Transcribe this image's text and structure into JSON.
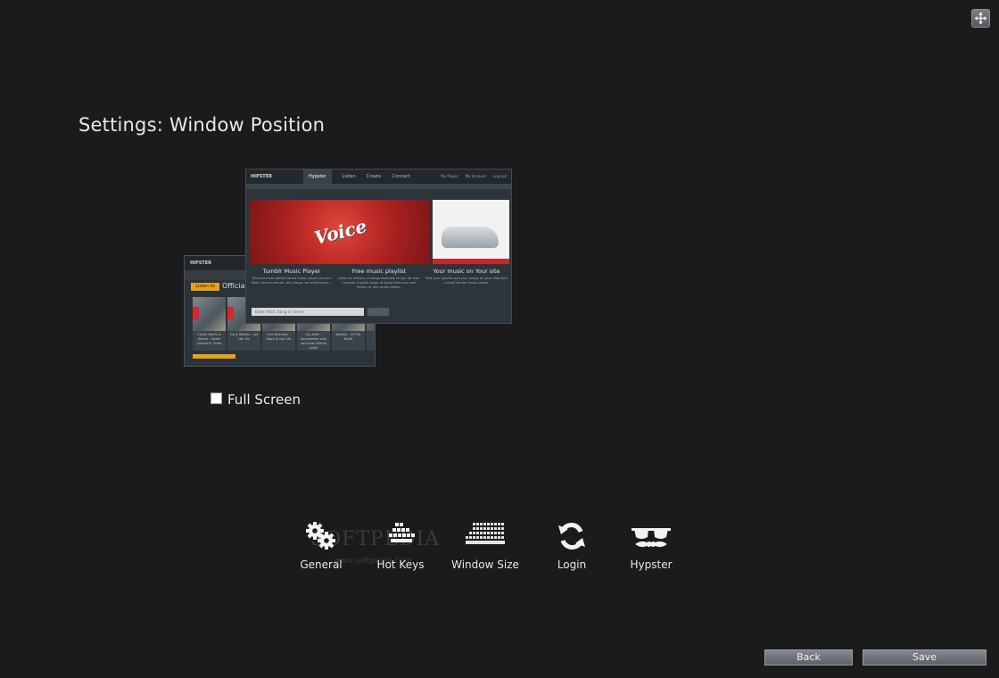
{
  "title": "Settings: Window Position",
  "fullscreen": {
    "label": "Full Screen",
    "checked": false
  },
  "preview": {
    "front": {
      "logo": "HIPSTER",
      "nav": [
        "Hypster",
        "Listen",
        "Create",
        "Connect"
      ],
      "right_links": [
        "My Player",
        "My Account",
        "Log out"
      ],
      "banner_text": "Voice",
      "columns": [
        {
          "heading": "Tumblr Music Player",
          "text": "Find out more details about music player on your blog. How to embed, why songs not working etc..."
        },
        {
          "heading": "Free music playlist",
          "text": "Listen to millions of songs available to you for free. Uncover a great range of songs from our vast library of free music online."
        },
        {
          "heading": "Your music on Your site",
          "text": "Post your playlist and your songs on your blog with a small tumblr music player."
        }
      ],
      "search_placeholder": "Enter Artist, Song or Genre"
    },
    "back": {
      "logo": "HIPSTER",
      "tab": "Listen to",
      "heading": "Official U",
      "thumbs": [
        "Calvin Harris & Alesso - Under Control ft. Hurts",
        "Carly Rothon - Let Her Go",
        "One Direction - Story of my Life",
        "Lily Allen - Somewhere only we know Official Audio",
        "Bastille - Of The Night",
        "Me"
      ]
    }
  },
  "watermark": {
    "text": "SOFTPEDIA",
    "sub": "www.softpedia.com"
  },
  "nav": [
    {
      "label": "General",
      "icon": "gears-icon"
    },
    {
      "label": "Hot Keys",
      "icon": "keyboard-keys-icon"
    },
    {
      "label": "Window Size",
      "icon": "keyboard-grid-icon"
    },
    {
      "label": "Login",
      "icon": "refresh-icon"
    },
    {
      "label": "Hypster",
      "icon": "sunglasses-mustache-icon"
    }
  ],
  "buttons": {
    "back": "Back",
    "save": "Save"
  }
}
